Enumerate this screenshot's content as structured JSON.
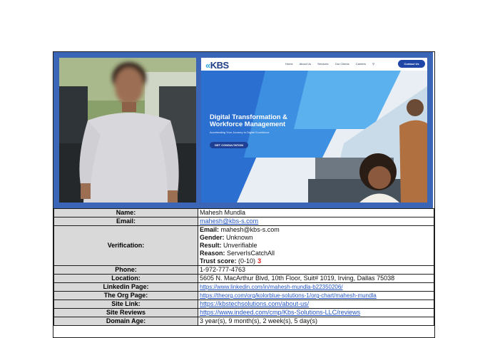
{
  "website": {
    "logo": "KBS",
    "nav": [
      "Home",
      "About Us",
      "Services",
      "Our Clients",
      "Careers"
    ],
    "contact_button": "Contact Us",
    "hero_title": "Digital Transformation & Workforce Management",
    "hero_subtitle": "Accelerating Your Journey to Digital Excellence",
    "hero_button": "GET CONSULTATION"
  },
  "rows": {
    "name": {
      "label": "Name:",
      "value": "Mahesh Mundla"
    },
    "email": {
      "label": "Email:",
      "value": "mahesh@kbs-s.com"
    },
    "verification": {
      "label": "Verification:",
      "email_label": "Email:",
      "email_value": "mahesh@kbs-s.com",
      "gender_label": "Gender:",
      "gender_value": "Unknown",
      "result_label": "Result:",
      "result_value": "Unverifiable",
      "reason_label": "Reason:",
      "reason_value": "ServerIsCatchAll",
      "trust_label": "Trust score:",
      "trust_range": "(0-10)",
      "trust_value": "3"
    },
    "phone": {
      "label": "Phone:",
      "value": "1-972-777-4763"
    },
    "location": {
      "label": "Location:",
      "value": "5605 N. MacArthur Blvd, 10th Floor, Suit# 1019, Irving, Dallas 75038"
    },
    "linkedin": {
      "label": "Linkedin Page:",
      "value": "https://www.linkedin.com/in/mahesh-mundla-b22350206/"
    },
    "org": {
      "label": "The Org Page:",
      "value": "https://theorg.com/org/kolorblue-solutions-1/org-chart/mahesh-mundla"
    },
    "site": {
      "label": "Site Link:",
      "value": "https://kbstechsolutions.com/about-us/"
    },
    "reviews": {
      "label": "Site Reviews",
      "value": "https://www.indeed.com/cmp/Kbs-Solutions-LLC/reviews"
    },
    "domain_age": {
      "label": "Domain Age:",
      "value": "3 year(s), 9 month(s), 2 week(s), 5 day(s)"
    }
  },
  "colors": {
    "banner": "#3b66b8",
    "label_bg": "#d9d9d9",
    "link": "#2456c4",
    "score": "#e21d1d"
  }
}
